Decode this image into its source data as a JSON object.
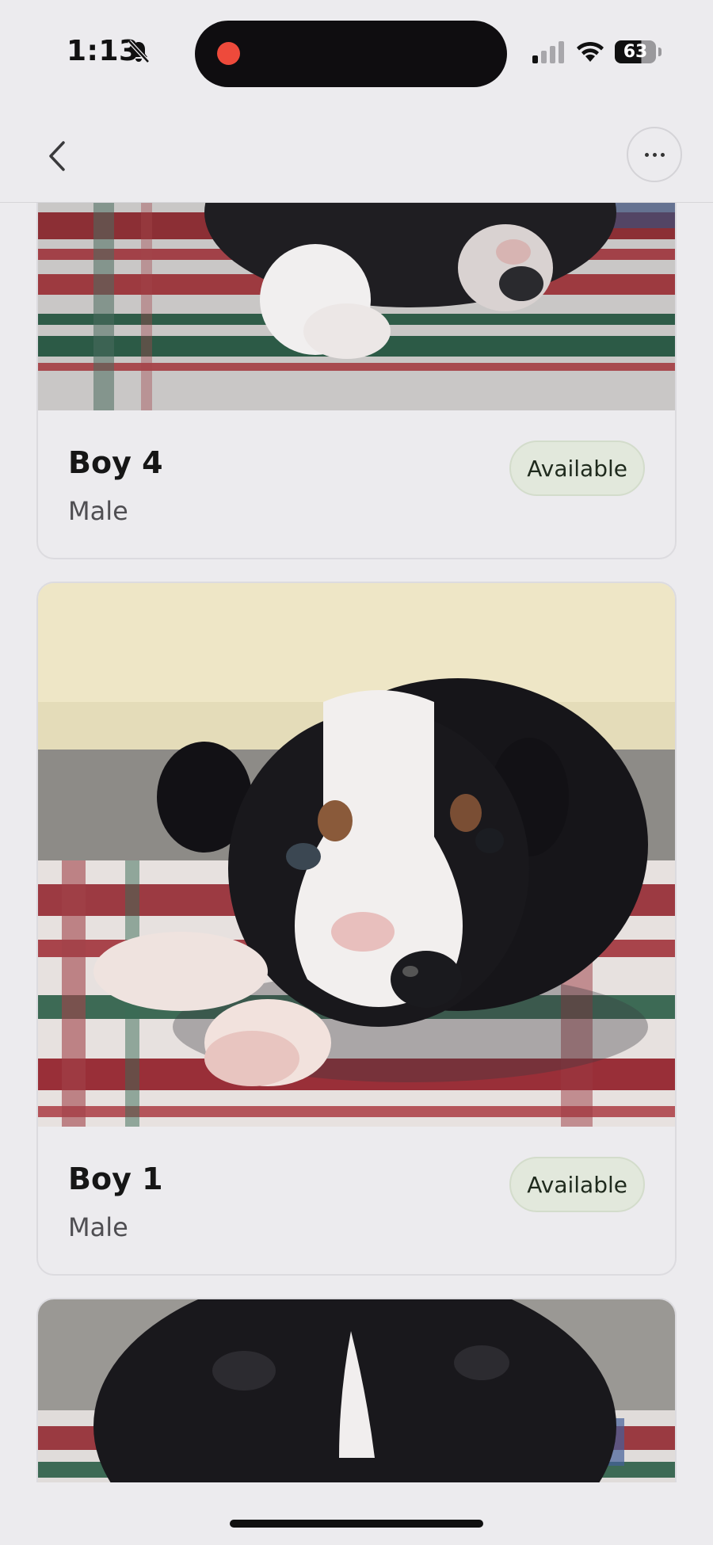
{
  "status_bar": {
    "time": "1:13",
    "battery": "63",
    "icons": [
      "bell-slash-icon",
      "cellular-signal-icon",
      "wifi-icon",
      "battery-icon"
    ],
    "recording_color": "#ee4a3b"
  },
  "nav": {
    "back_icon": "chevron-left-icon",
    "more_icon": "ellipsis-icon"
  },
  "listings": [
    {
      "name": "Boy 4",
      "sex": "Male",
      "status": "Available"
    },
    {
      "name": "Boy 1",
      "sex": "Male",
      "status": "Available"
    }
  ],
  "colors": {
    "background": "#ecebee",
    "badge_background": "#e2e8dc",
    "text": "#161616",
    "muted_text": "#4f4e52"
  }
}
